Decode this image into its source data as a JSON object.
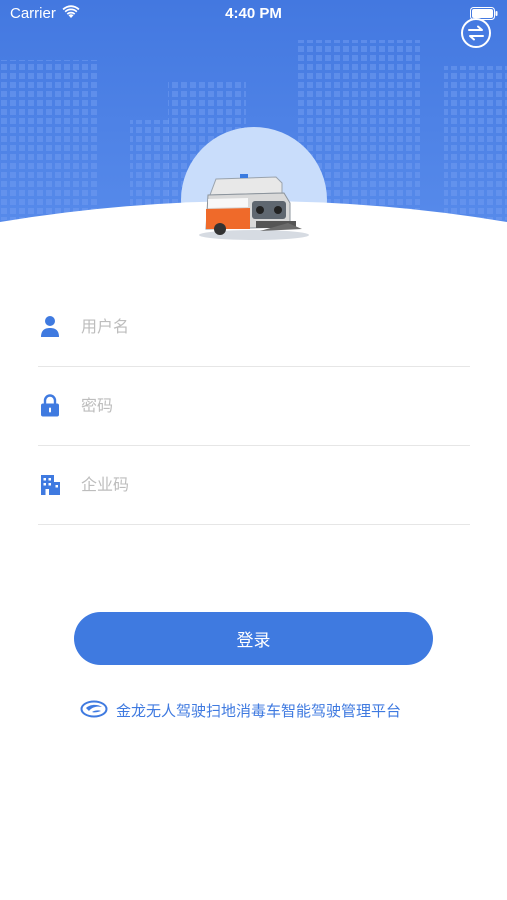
{
  "status_bar": {
    "carrier": "Carrier",
    "time": "4:40 PM"
  },
  "header": {
    "background_color": "#4a80e6",
    "switch_icon": "swap-arrows-icon"
  },
  "form": {
    "username": {
      "placeholder": "用户名",
      "value": "",
      "icon": "user-icon"
    },
    "password": {
      "placeholder": "密码",
      "value": "",
      "icon": "lock-icon"
    },
    "company_code": {
      "placeholder": "企业码",
      "value": "",
      "icon": "building-icon"
    }
  },
  "login_button": {
    "label": "登录",
    "color": "#3f7ae0"
  },
  "footer": {
    "brand_text": "金龙无人驾驶扫地消毒车智能驾驶管理平台",
    "brand_logo": "king-long-logo-icon"
  }
}
